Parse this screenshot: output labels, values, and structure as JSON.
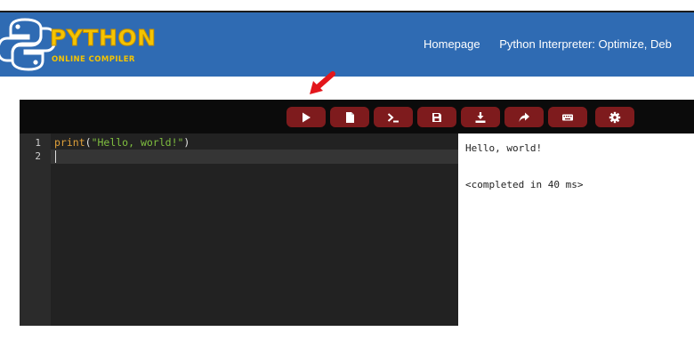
{
  "header": {
    "logo_title": "PYTHON",
    "logo_subtitle": "ONLINE COMPILER",
    "nav": [
      {
        "label": "Homepage"
      },
      {
        "label": "Python Interpreter: Optimize, Deb"
      }
    ]
  },
  "toolbar": {
    "buttons": [
      {
        "icon": "play-icon",
        "action": "run"
      },
      {
        "icon": "file-icon",
        "action": "new-file"
      },
      {
        "icon": "terminal-icon",
        "action": "console"
      },
      {
        "icon": "save-icon",
        "action": "save"
      },
      {
        "icon": "download-icon",
        "action": "download"
      },
      {
        "icon": "share-icon",
        "action": "share"
      },
      {
        "icon": "keyboard-icon",
        "action": "keyboard"
      },
      {
        "icon": "gear-icon",
        "action": "settings"
      }
    ]
  },
  "editor": {
    "line_numbers": [
      "1",
      "2"
    ],
    "code": {
      "fn": "print",
      "open_paren": "(",
      "string": "\"Hello, world!\"",
      "close_paren": ")"
    }
  },
  "output": {
    "line1": "Hello, world!",
    "line2": "<completed in 40 ms>"
  },
  "colors": {
    "header_bg": "#2f6bb3",
    "logo_yellow": "#f5c400",
    "button_bg": "#7e1b1d",
    "annotation_arrow": "#e3161b"
  }
}
